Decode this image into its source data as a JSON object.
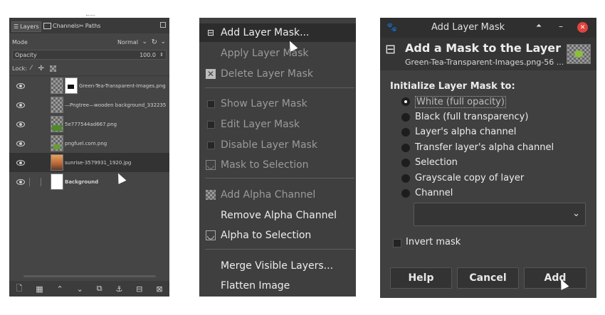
{
  "layers_panel": {
    "tabs": [
      {
        "label": "Layers",
        "icon": "layers-icon"
      },
      {
        "label": "Channels",
        "icon": "channels-icon"
      },
      {
        "label": "Paths",
        "icon": "paths-icon"
      }
    ],
    "mode_label": "Mode",
    "mode_value": "Normal",
    "opacity_label": "Opacity",
    "opacity_value": "100.0",
    "lock_label": "Lock:",
    "layers": [
      {
        "name": "Green-Tea-Transparent-Images.png",
        "selected": false,
        "has_mask": true
      },
      {
        "name": "—Pngtree—wooden background_332235",
        "selected": false,
        "has_mask": false
      },
      {
        "name": "5e777544ad667.png",
        "selected": false,
        "has_mask": false
      },
      {
        "name": "pngfuel.com.png",
        "selected": false,
        "has_mask": false
      },
      {
        "name": "sunrise-3579931_1920.jpg",
        "selected": true,
        "has_mask": false
      },
      {
        "name": "Background",
        "selected": false,
        "has_mask": false
      }
    ]
  },
  "layer_menu": {
    "items": [
      {
        "label": "Add Layer Mask...",
        "enabled": true,
        "highlighted": true,
        "icon": "add-mask-icon"
      },
      {
        "label": "Apply Layer Mask",
        "enabled": false,
        "icon": ""
      },
      {
        "label": "Delete Layer Mask",
        "enabled": false,
        "icon": "delete-mask-icon"
      },
      {
        "label": "Show Layer Mask",
        "enabled": false,
        "icon": "checkbox-icon"
      },
      {
        "label": "Edit Layer Mask",
        "enabled": false,
        "icon": "checkbox-icon"
      },
      {
        "label": "Disable Layer Mask",
        "enabled": false,
        "icon": "checkbox-icon"
      },
      {
        "label": "Mask to Selection",
        "enabled": false,
        "icon": "mask-selection-icon"
      },
      {
        "label": "Add Alpha Channel",
        "enabled": false,
        "icon": "alpha-channel-icon"
      },
      {
        "label": "Remove Alpha Channel",
        "enabled": true,
        "icon": ""
      },
      {
        "label": "Alpha to Selection",
        "enabled": true,
        "icon": "alpha-selection-icon"
      },
      {
        "label": "Merge Visible Layers...",
        "enabled": true,
        "icon": ""
      },
      {
        "label": "Flatten Image",
        "enabled": true,
        "icon": ""
      }
    ]
  },
  "dialog": {
    "window_title": "Add Layer Mask",
    "heading": "Add a Mask to the Layer",
    "subheading": "Green-Tea-Transparent-Images.png-56 ...",
    "section_label": "Initialize Layer Mask to:",
    "options": [
      {
        "label": "White (full opacity)",
        "selected": true
      },
      {
        "label": "Black (full transparency)",
        "selected": false
      },
      {
        "label": "Layer's alpha channel",
        "selected": false
      },
      {
        "label": "Transfer layer's alpha channel",
        "selected": false
      },
      {
        "label": "Selection",
        "selected": false
      },
      {
        "label": "Grayscale copy of layer",
        "selected": false
      },
      {
        "label": "Channel",
        "selected": false
      }
    ],
    "channel_dropdown_value": "",
    "invert_label": "Invert mask",
    "invert_checked": false,
    "buttons": {
      "help": "Help",
      "cancel": "Cancel",
      "add": "Add"
    }
  },
  "colors": {
    "panel_bg": "#454545",
    "menu_bg": "#3f3f3f",
    "dialog_bg": "#404040",
    "close_button": "#e0443e"
  }
}
